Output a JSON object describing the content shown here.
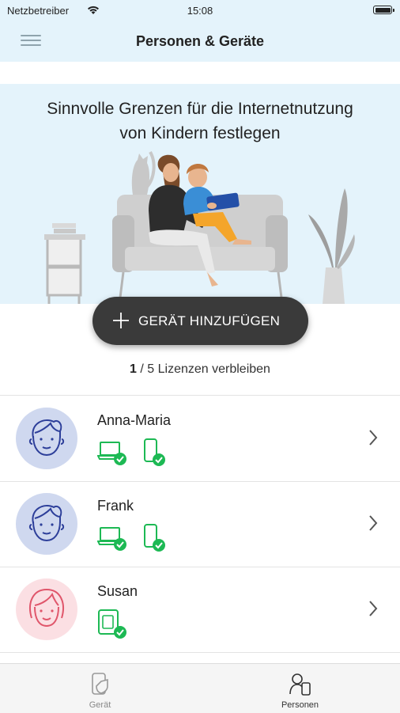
{
  "status_bar": {
    "carrier": "Netzbetreiber",
    "time": "15:08"
  },
  "navbar": {
    "title": "Personen & Geräte"
  },
  "hero": {
    "headline_line1": "Sinnvolle Grenzen für die Internetnutzung",
    "headline_line2": "von Kindern festlegen"
  },
  "add_button": {
    "label": "GERÄT HINZUFÜGEN"
  },
  "licenses": {
    "used": "1",
    "rest": " / 5 Lizenzen verbleiben"
  },
  "people": [
    {
      "name": "Anna-Maria",
      "avatar": "male-avatar-icon",
      "devices": [
        "laptop-check-icon",
        "phone-check-icon"
      ]
    },
    {
      "name": "Frank",
      "avatar": "male-avatar-icon",
      "devices": [
        "laptop-check-icon",
        "phone-check-icon"
      ]
    },
    {
      "name": "Susan",
      "avatar": "female-avatar-icon",
      "devices": [
        "tablet-check-icon"
      ]
    }
  ],
  "tabs": [
    {
      "label": "Gerät",
      "icon": "device-shield-icon"
    },
    {
      "label": "Personen",
      "icon": "people-device-icon"
    }
  ],
  "colors": {
    "header_bg": "#e4f3fb",
    "button_bg": "#3a3a3a",
    "check_green": "#1db954",
    "male_avatar_bg": "#cfd8ef",
    "male_avatar_line": "#2d3f9a",
    "female_avatar_bg": "#fbdfe3",
    "female_avatar_line": "#e0566b"
  }
}
